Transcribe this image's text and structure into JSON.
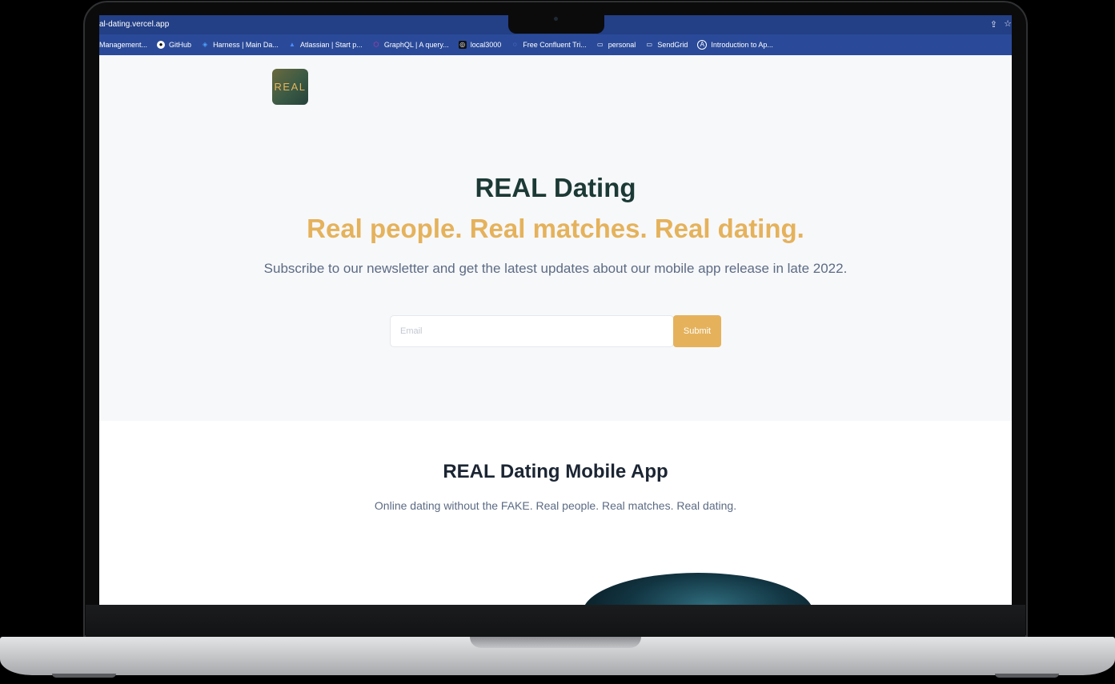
{
  "browser": {
    "url": "al-dating.vercel.app",
    "bookmarks": [
      {
        "label": "Management...",
        "icon": "none"
      },
      {
        "label": "GitHub",
        "icon": "github-icon"
      },
      {
        "label": "Harness | Main Da...",
        "icon": "harness-icon"
      },
      {
        "label": "Atlassian | Start p...",
        "icon": "atlassian-icon"
      },
      {
        "label": "GraphQL | A query...",
        "icon": "graphql-icon"
      },
      {
        "label": "local3000",
        "icon": "local-icon"
      },
      {
        "label": "Free Confluent Tri...",
        "icon": "confluent-icon"
      },
      {
        "label": "personal",
        "icon": "folder-icon"
      },
      {
        "label": "SendGrid",
        "icon": "folder-icon"
      },
      {
        "label": "Introduction to Ap...",
        "icon": "apollo-icon"
      }
    ]
  },
  "logo": {
    "text": "REAL"
  },
  "hero": {
    "title": "REAL Dating",
    "tagline": "Real people. Real matches. Real dating.",
    "subtitle": "Subscribe to our newsletter and get the latest updates about our mobile app release in late 2022.",
    "email_placeholder": "Email",
    "submit_label": "Submit"
  },
  "app_section": {
    "title": "REAL Dating Mobile App",
    "subtitle": "Online dating without the FAKE. Real people. Real matches. Real dating."
  },
  "colors": {
    "accent": "#e5b25b",
    "heading": "#1c3a35",
    "browser_bar": "#2a4a99"
  }
}
